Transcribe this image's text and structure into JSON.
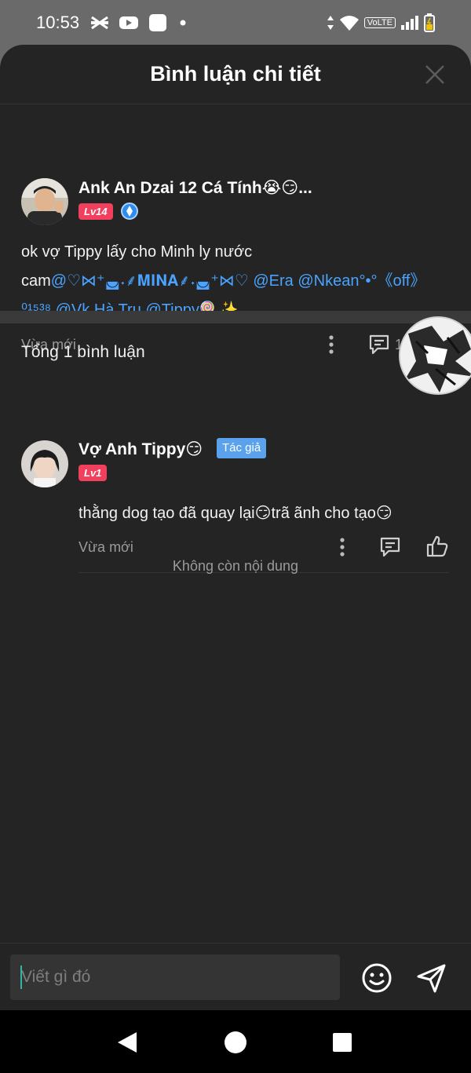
{
  "status_bar": {
    "time": "10:53",
    "volte": "VoLTE"
  },
  "sheet": {
    "title": "Bình luận chi tiết"
  },
  "main_comment": {
    "author": "Ank An Dzai 12 Cá Tính😭😏...",
    "level": "Lv14",
    "text_plain": "ok vợ Tippy lấy cho Minh ly nước",
    "text_line2_start": "cam",
    "mentions_line2": "@♡⋈⁺◛˖⸙𝐌𝐈𝐍𝐀⸙˖◛⁺⋈♡ @Era @Nkean°•°《off》",
    "mentions_line3": "⁰¹⁵³⁸ @Vk Hà Trụ @Tippy🍭✨",
    "time": "Vừa mới",
    "reply_count": "1"
  },
  "replies_section": {
    "total_label": "Tổng 1 bình luận",
    "end_label": "Không còn nội dung"
  },
  "reply": {
    "author": "Vợ Anh Tippy😏",
    "author_badge": "Tác giả",
    "level": "Lv1",
    "text": "thằng dog tạo đã quay lại😏trã ãnh cho tạo😏",
    "time": "Vừa mới"
  },
  "input": {
    "placeholder": "Viết gì đó"
  },
  "colors": {
    "accent_link": "#4aa3ff",
    "level_badge": "#f0405e",
    "author_badge": "#5aa2ee",
    "sheet_bg": "#242424"
  },
  "icons": [
    "close-icon",
    "more-icon",
    "comment-icon",
    "like-icon",
    "emoji-icon",
    "send-icon",
    "back-icon",
    "home-icon",
    "recents-icon"
  ]
}
